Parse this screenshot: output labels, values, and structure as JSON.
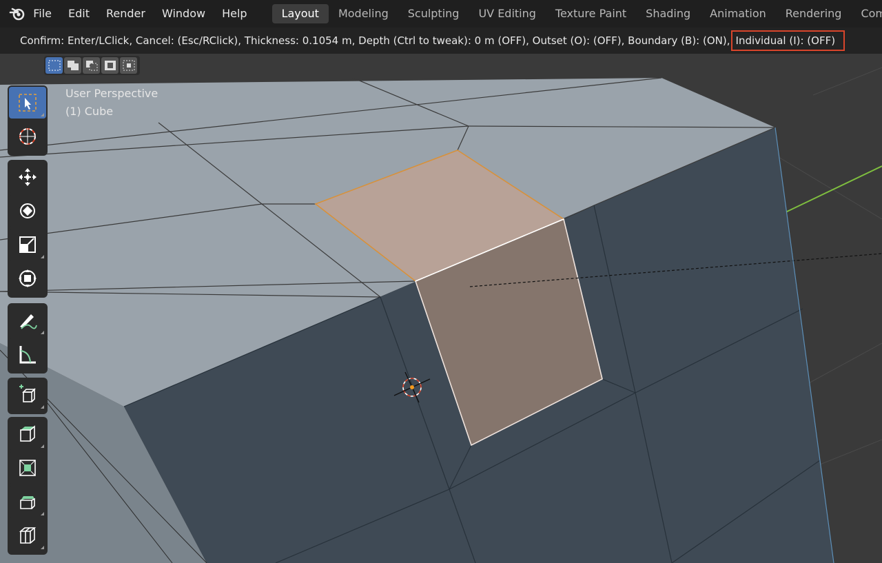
{
  "menubar": {
    "logo_icon": "blender-logo-icon",
    "items": [
      "File",
      "Edit",
      "Render",
      "Window",
      "Help"
    ]
  },
  "workspaces": {
    "tabs": [
      "Layout",
      "Modeling",
      "Sculpting",
      "UV Editing",
      "Texture Paint",
      "Shading",
      "Animation",
      "Rendering",
      "Composit"
    ],
    "active": "Layout"
  },
  "header": {
    "status_text": "Confirm: Enter/LClick, Cancel: (Esc/RClick), Thickness: 0.1054 m, Depth (Ctrl to tweak): 0 m (OFF), Outset (O): (OFF), Boundary (B): (ON),",
    "highlighted_text": "Individual (I): (OFF)",
    "highlight_color": "#d9452b"
  },
  "viewport": {
    "view_name": "User Perspective",
    "object_name": "(1) Cube",
    "selection_modes": [
      "select-box-icon",
      "select-extend-icon",
      "select-subtract-icon",
      "select-invert-icon",
      "select-intersect-icon"
    ],
    "tools": [
      "select-box-icon",
      "cursor-icon",
      "move-icon",
      "rotate-icon",
      "scale-icon",
      "transform-icon",
      "annotate-icon",
      "measure-icon",
      "add-cube-icon",
      "extrude-region-icon",
      "inset-faces-icon",
      "bevel-icon",
      "loop-cut-icon"
    ],
    "colors": {
      "mesh_top": "#9aa3ab",
      "mesh_side": "#3f4a55",
      "selected_face_top": "#b8a297",
      "selected_face_side": "#85756c",
      "active_tool": "#4772b3",
      "axis_y": "#7fbf3f",
      "axis_x": "#c74860"
    }
  }
}
